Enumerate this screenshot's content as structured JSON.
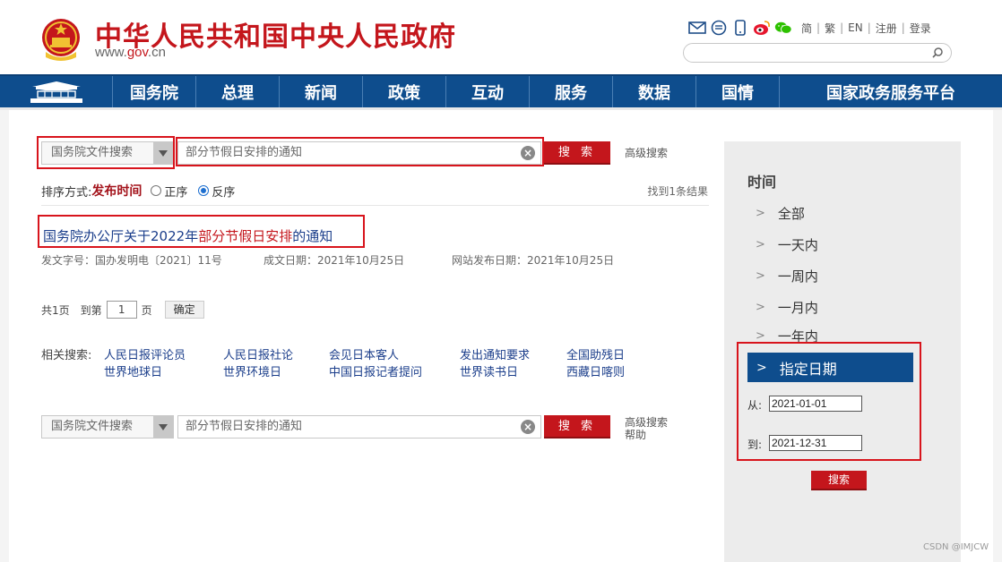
{
  "header": {
    "site_title": "中华人民共和国中央人民政府",
    "site_url_prefix": "www.",
    "site_url_domain": "gov",
    "site_url_suffix": ".cn",
    "links": [
      "简",
      "繁",
      "EN",
      "注册",
      "登录"
    ],
    "icons": [
      "mail-icon",
      "chat-icon",
      "mobile-icon",
      "weibo-icon",
      "wechat-icon"
    ]
  },
  "nav": {
    "items": [
      "国务院",
      "总理",
      "新闻",
      "政策",
      "互动",
      "服务",
      "数据",
      "国情",
      "国家政务服务平台"
    ]
  },
  "search_top": {
    "scope": "国务院文件搜索",
    "query": "部分节假日安排的通知",
    "button": "搜 索",
    "advanced": "高级搜索"
  },
  "sort": {
    "label": "排序方式:",
    "current": "发布时间",
    "option_asc": "正序",
    "option_desc": "反序",
    "selected": "反序"
  },
  "result_count": "找到1条结果",
  "result": {
    "title_pre": "国务院办公厅关于2022年",
    "title_hl": "部分节假日安排",
    "title_post": "的通知",
    "doc_no": "发文字号：国办发明电〔2021〕11号",
    "written_date": "成文日期：2021年10月25日",
    "publish_date": "网站发布日期：2021年10月25日"
  },
  "pager": {
    "total": "共1页",
    "goto": "到第",
    "page": "1",
    "unit": "页",
    "ok": "确定"
  },
  "related": {
    "label": "相关搜索:",
    "items": [
      "人民日报评论员",
      "人民日报社论",
      "会见日本客人",
      "发出通知要求",
      "全国助残日",
      "世界地球日",
      "世界环境日",
      "中国日报记者提问",
      "世界读书日",
      "西藏日喀则"
    ]
  },
  "search_bottom": {
    "scope": "国务院文件搜索",
    "query": "部分节假日安排的通知",
    "button": "搜 索",
    "advanced": "高级搜索",
    "help": "帮助"
  },
  "sidebar": {
    "title": "时间",
    "items": [
      "全部",
      "一天内",
      "一周内",
      "一月内",
      "一年内"
    ],
    "active": "指定日期",
    "from_label": "从:",
    "from_value": "2021-01-01",
    "to_label": "到:",
    "to_value": "2021-12-31",
    "button": "搜索"
  },
  "watermark": "CSDN @IMJCW",
  "colors": {
    "brand_red": "#c4161c",
    "nav_blue": "#0e4d8d",
    "link_blue": "#1b3e8b",
    "annotation_red": "#d8141c"
  }
}
